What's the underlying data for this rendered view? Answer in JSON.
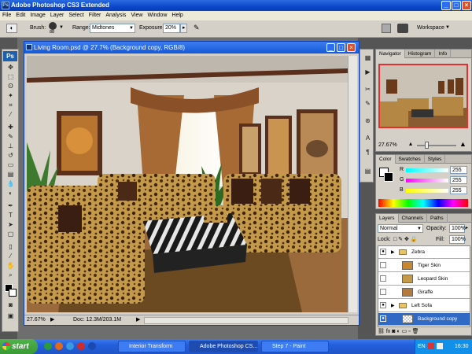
{
  "app": {
    "title": "Adobe Photoshop CS3 Extended",
    "logo": "Ps"
  },
  "menu": [
    "File",
    "Edit",
    "Image",
    "Layer",
    "Select",
    "Filter",
    "Analysis",
    "View",
    "Window",
    "Help"
  ],
  "options": {
    "brush_label": "Brush:",
    "brush_size": "88",
    "range_label": "Range:",
    "range_value": "Midtones",
    "exposure_label": "Exposure:",
    "exposure_value": "20%",
    "workspace_label": "Workspace"
  },
  "document": {
    "title": "Living Room.psd @ 27.7% (Background copy, RGB/8)",
    "zoom": "27.67%",
    "doc_info": "Doc: 12.3M/203.1M"
  },
  "navigator": {
    "tabs": [
      "Navigator",
      "Histogram",
      "Info"
    ],
    "zoom": "27.67%"
  },
  "color": {
    "tabs": [
      "Color",
      "Swatches",
      "Styles"
    ],
    "r": "255",
    "g": "255",
    "b": "255",
    "r_label": "R",
    "g_label": "G",
    "b_label": "B"
  },
  "layers": {
    "tabs": [
      "Layers",
      "Channels",
      "Paths"
    ],
    "blend_mode": "Normal",
    "opacity_label": "Opacity:",
    "opacity": "100%",
    "lock_label": "Lock:",
    "fill_label": "Fill:",
    "fill": "100%",
    "rows": [
      {
        "name": "Zebra",
        "type": "group",
        "visible": true
      },
      {
        "name": "Tiger Skin",
        "type": "layer",
        "visible": false
      },
      {
        "name": "Leopard Skin",
        "type": "layer",
        "visible": false
      },
      {
        "name": "Giraffe",
        "type": "layer",
        "visible": false
      },
      {
        "name": "Left Sofa",
        "type": "group",
        "visible": true
      },
      {
        "name": "Background copy",
        "type": "layer",
        "visible": true,
        "selected": true
      }
    ]
  },
  "taskbar": {
    "start": "start",
    "tasks": [
      "Interior Transform",
      "Adobe Photoshop CS...",
      "Step 7 - Paint"
    ],
    "lang": "EN",
    "time": "16:30"
  },
  "colors": {
    "accent": "#0a3fb6",
    "selected_layer": "#316ac5",
    "leopard": "#c49a4a"
  }
}
